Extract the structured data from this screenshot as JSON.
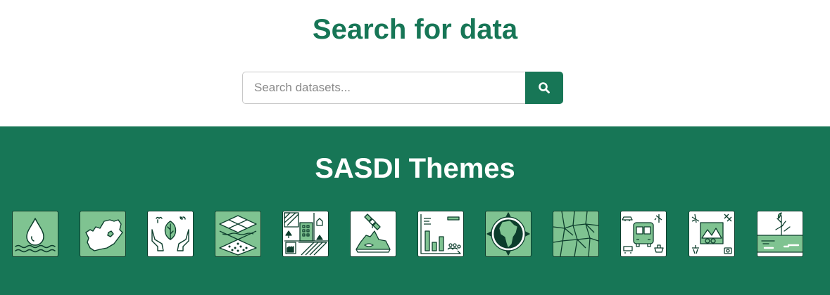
{
  "header": {
    "title": "Search for data"
  },
  "search": {
    "placeholder": "Search datasets...",
    "button_icon": "search-icon"
  },
  "themes": {
    "title": "SASDI Themes",
    "items": [
      {
        "icon": "water-drop-icon",
        "tile_color": "#7fc391"
      },
      {
        "icon": "south-africa-map-icon",
        "tile_color": "#7fc391"
      },
      {
        "icon": "hands-leaf-icon",
        "tile_color": "#ffffff"
      },
      {
        "icon": "land-layers-icon",
        "tile_color": "#7fc391"
      },
      {
        "icon": "land-use-icon",
        "tile_color": "#ffffff"
      },
      {
        "icon": "satellite-terrain-icon",
        "tile_color": "#ffffff"
      },
      {
        "icon": "statistics-chart-icon",
        "tile_color": "#ffffff"
      },
      {
        "icon": "globe-africa-icon",
        "tile_color": "#7fc391"
      },
      {
        "icon": "parcels-map-icon",
        "tile_color": "#7fc391"
      },
      {
        "icon": "transport-bus-icon",
        "tile_color": "#ffffff"
      },
      {
        "icon": "tourism-icon",
        "tile_color": "#ffffff"
      },
      {
        "icon": "wetland-icon",
        "tile_color": "#ffffff"
      }
    ]
  },
  "colors": {
    "brand_green": "#177656",
    "light_green": "#7fc391",
    "icon_stroke": "#0c3d2c"
  }
}
